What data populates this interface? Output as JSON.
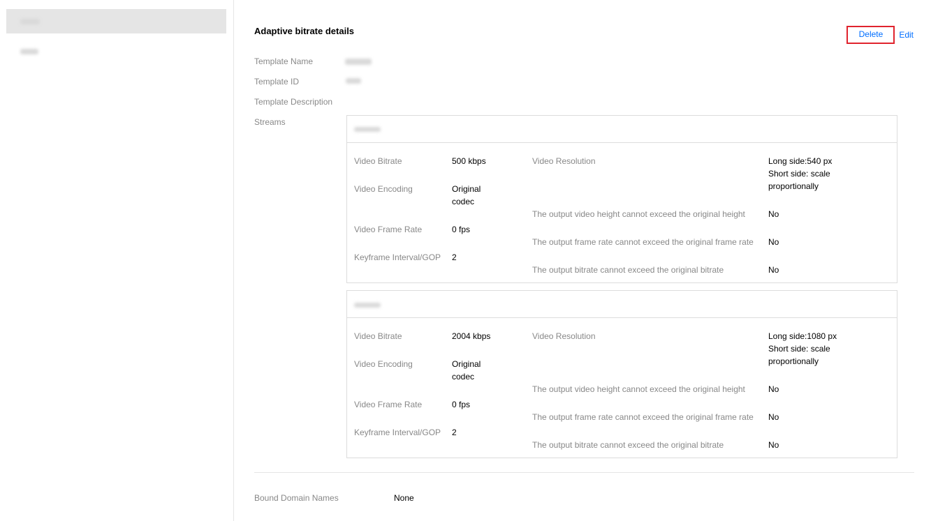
{
  "page": {
    "title": "Adaptive bitrate details",
    "actions": {
      "delete_label": "Delete",
      "edit_label": "Edit"
    }
  },
  "info": {
    "template_name_label": "Template Name",
    "template_id_label": "Template ID",
    "template_description_label": "Template Description",
    "streams_label": "Streams"
  },
  "streams": [
    {
      "video_bitrate_label": "Video Bitrate",
      "video_bitrate": "500 kbps",
      "video_encoding_label": "Video Encoding",
      "video_encoding": "Original codec",
      "frame_rate_label": "Video Frame Rate",
      "frame_rate": "0 fps",
      "gop_label": "Keyframe Interval/GOP",
      "gop": "2",
      "resolution_label": "Video Resolution",
      "resolution_long": "Long side:540 px",
      "resolution_short": "Short side: scale proportionally",
      "height_limit_label": "The output video height cannot exceed the original height",
      "height_limit": "No",
      "framerate_limit_label": "The output frame rate cannot exceed the original frame rate",
      "framerate_limit": "No",
      "bitrate_limit_label": "The output bitrate cannot exceed the original bitrate",
      "bitrate_limit": "No"
    },
    {
      "video_bitrate_label": "Video Bitrate",
      "video_bitrate": "2004 kbps",
      "video_encoding_label": "Video Encoding",
      "video_encoding": "Original codec",
      "frame_rate_label": "Video Frame Rate",
      "frame_rate": "0 fps",
      "gop_label": "Keyframe Interval/GOP",
      "gop": "2",
      "resolution_label": "Video Resolution",
      "resolution_long": "Long side:1080 px",
      "resolution_short": "Short side: scale proportionally",
      "height_limit_label": "The output video height cannot exceed the original height",
      "height_limit": "No",
      "framerate_limit_label": "The output frame rate cannot exceed the original frame rate",
      "framerate_limit": "No",
      "bitrate_limit_label": "The output bitrate cannot exceed the original bitrate",
      "bitrate_limit": "No"
    }
  ],
  "bound_domains": {
    "label": "Bound Domain Names",
    "value": "None"
  },
  "colors": {
    "link": "#006eff",
    "highlight_border": "#e0232d",
    "muted": "#888888"
  }
}
